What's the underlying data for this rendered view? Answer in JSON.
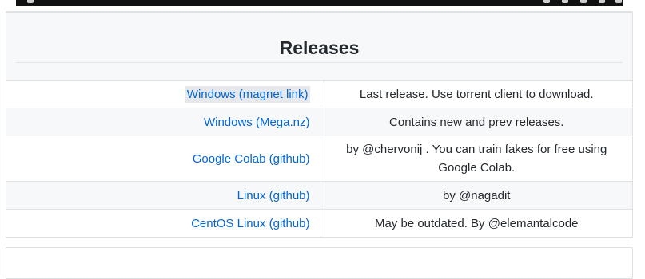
{
  "section": {
    "title": "Releases"
  },
  "releases": [
    {
      "label": "Windows (magnet link)",
      "description": "Last release. Use torrent client to download."
    },
    {
      "label": "Windows (Mega.nz)",
      "description": "Contains new and prev releases."
    },
    {
      "label": "Google Colab (github)",
      "description": "by @chervonij . You can train fakes for free using Google Colab."
    },
    {
      "label": "Linux (github)",
      "description": "by @nagadit"
    },
    {
      "label": "CentOS Linux (github)",
      "description": "May be outdated. By @elemantalcode"
    }
  ],
  "colors": {
    "link": "#0366d6",
    "border": "#dfe2e5",
    "alt_row": "#f6f8fa",
    "highlight": "#e6e8ec"
  },
  "icons": [
    "play-icon",
    "settings-icon",
    "fullscreen-icon"
  ]
}
